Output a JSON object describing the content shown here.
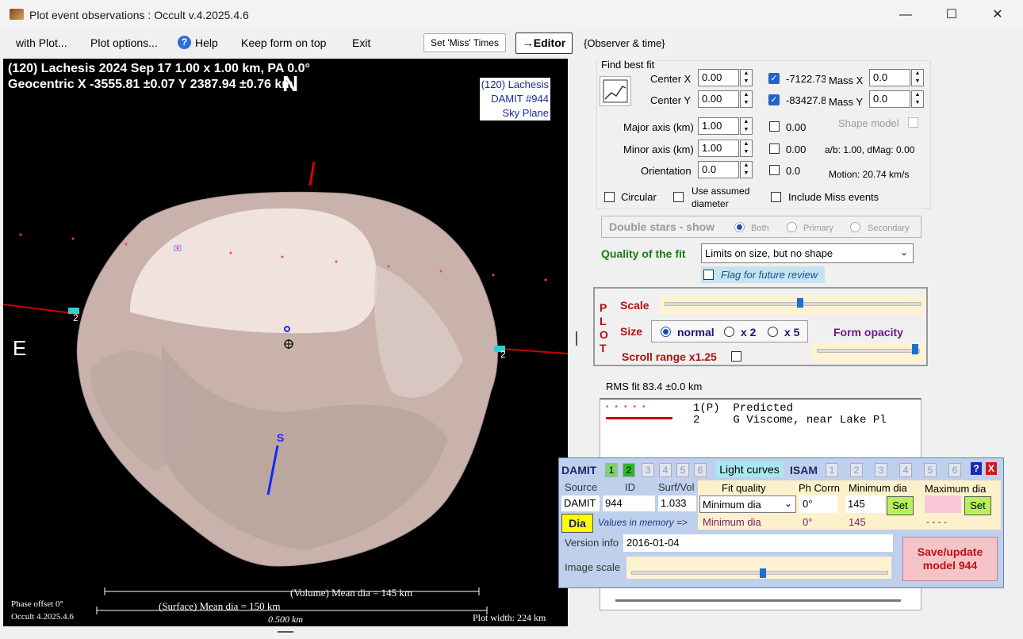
{
  "window": {
    "title": "Plot event observations : Occult v.4.2025.4.6",
    "minimize": "—",
    "maximize": "☐",
    "close": "✕"
  },
  "menu": {
    "with_plot": "with Plot...",
    "plot_options": "Plot options...",
    "help": "Help",
    "keep_on_top": "Keep form on top",
    "exit": "Exit",
    "set_miss_times": "Set 'Miss' Times",
    "editor": "→Editor",
    "observer_time": "{Observer & time}"
  },
  "plot": {
    "header_line1": "(120) Lachesis  2024 Sep 17   1.00 x 1.00 km, PA 0.0°",
    "header_line2": "Geocentric  X  -3555.81 ±0.07  Y 2387.94 ±0.76 km",
    "north": "N",
    "east": "E",
    "south": "S",
    "legend_line1": "(120) Lachesis",
    "legend_line2": "DAMIT #944",
    "legend_line3": "Sky Plane",
    "chord_label_left": "2",
    "chord_label_right": "2",
    "phase_offset": "Phase offset 0°",
    "version": "Occult 4.2025.4.6",
    "volume_dia": "(Volume) Mean dia = 145 km",
    "surface_dia": "(Surface) Mean dia = 150 km",
    "scale_bar": "0.500 km",
    "plot_width": "Plot width: 224 km"
  },
  "fit": {
    "group_title": "Find best fit",
    "center_x_label": "Center X",
    "center_x": "0.00",
    "center_y_label": "Center Y",
    "center_y": "0.00",
    "major_label": "Major axis (km)",
    "major": "1.00",
    "minor_label": "Minor axis (km)",
    "minor": "1.00",
    "orient_label": "Orientation",
    "orient": "0.0",
    "x_check_val": "-7122.73",
    "y_check_val": "-83427.8",
    "major_check_val": "0.00",
    "minor_check_val": "0.00",
    "orient_check_val": "0.0",
    "mass_x_label": "Mass X",
    "mass_x": "0.0",
    "mass_y_label": "Mass Y",
    "mass_y": "0.0",
    "shape_model": "Shape model",
    "ab_dmag": "a/b: 1.00, dMag: 0.00",
    "motion": "Motion: 20.74 km/s",
    "circular": "Circular",
    "use_assumed": "Use assumed",
    "diameter": "diameter",
    "include_miss": "Include Miss events",
    "double_stars": "Double stars - show",
    "both": "Both",
    "primary": "Primary",
    "secondary": "Secondary",
    "quality_label": "Quality of the fit",
    "quality_value": "Limits on size, but no shape",
    "flag_review": "Flag for future review"
  },
  "plotctl": {
    "side_label": "PLOT",
    "scale": "Scale",
    "size": "Size",
    "normal": "normal",
    "x2": "x 2",
    "x5": "x 5",
    "form_opacity": "Form opacity",
    "scroll_range": "Scroll range x1.25"
  },
  "rms": "RMS fit 83.4 ±0.0 km",
  "legend_list": {
    "row1": "1(P)  Predicted",
    "row2": "2     G Viscome, near Lake Pl"
  },
  "damit": {
    "title": "DAMIT",
    "nums": [
      "1",
      "2",
      "3",
      "4",
      "5",
      "6"
    ],
    "light_curves": "Light curves",
    "isam": "ISAM",
    "isam_nums": [
      "1",
      "2",
      "3",
      "4",
      "5",
      "6"
    ],
    "help": "?",
    "close": "X",
    "source_h": "Source",
    "id_h": "ID",
    "surfvol_h": "Surf/Vol",
    "source": "DAMIT",
    "id": "944",
    "surfvol": "1.033",
    "fit_quality_h": "Fit quality",
    "phcorrn_h": "Ph Corrn",
    "min_dia_h": "Minimum dia",
    "max_dia_h": "Maximum dia",
    "fit_quality": "Minimum dia",
    "phcorrn": "0°",
    "min_dia": "145",
    "set": "Set",
    "dia_btn": "Dia",
    "values_mem": "Values in memory =>",
    "mem_fit": "Minimum dia",
    "mem_ph": "0°",
    "mem_min": "145",
    "mem_max": "- - - -",
    "version_label": "Version info",
    "version": "2016-01-04",
    "image_scale": "Image scale",
    "save": "Save/update\nmodel 944"
  },
  "colors": {
    "accent": "#2563c9",
    "plot_bg": "#000000",
    "damit_bg": "#bfd0ec",
    "save_bg": "#f4c4c8",
    "quality_green": "#1a7a1a",
    "plot_red": "#cc0000"
  }
}
